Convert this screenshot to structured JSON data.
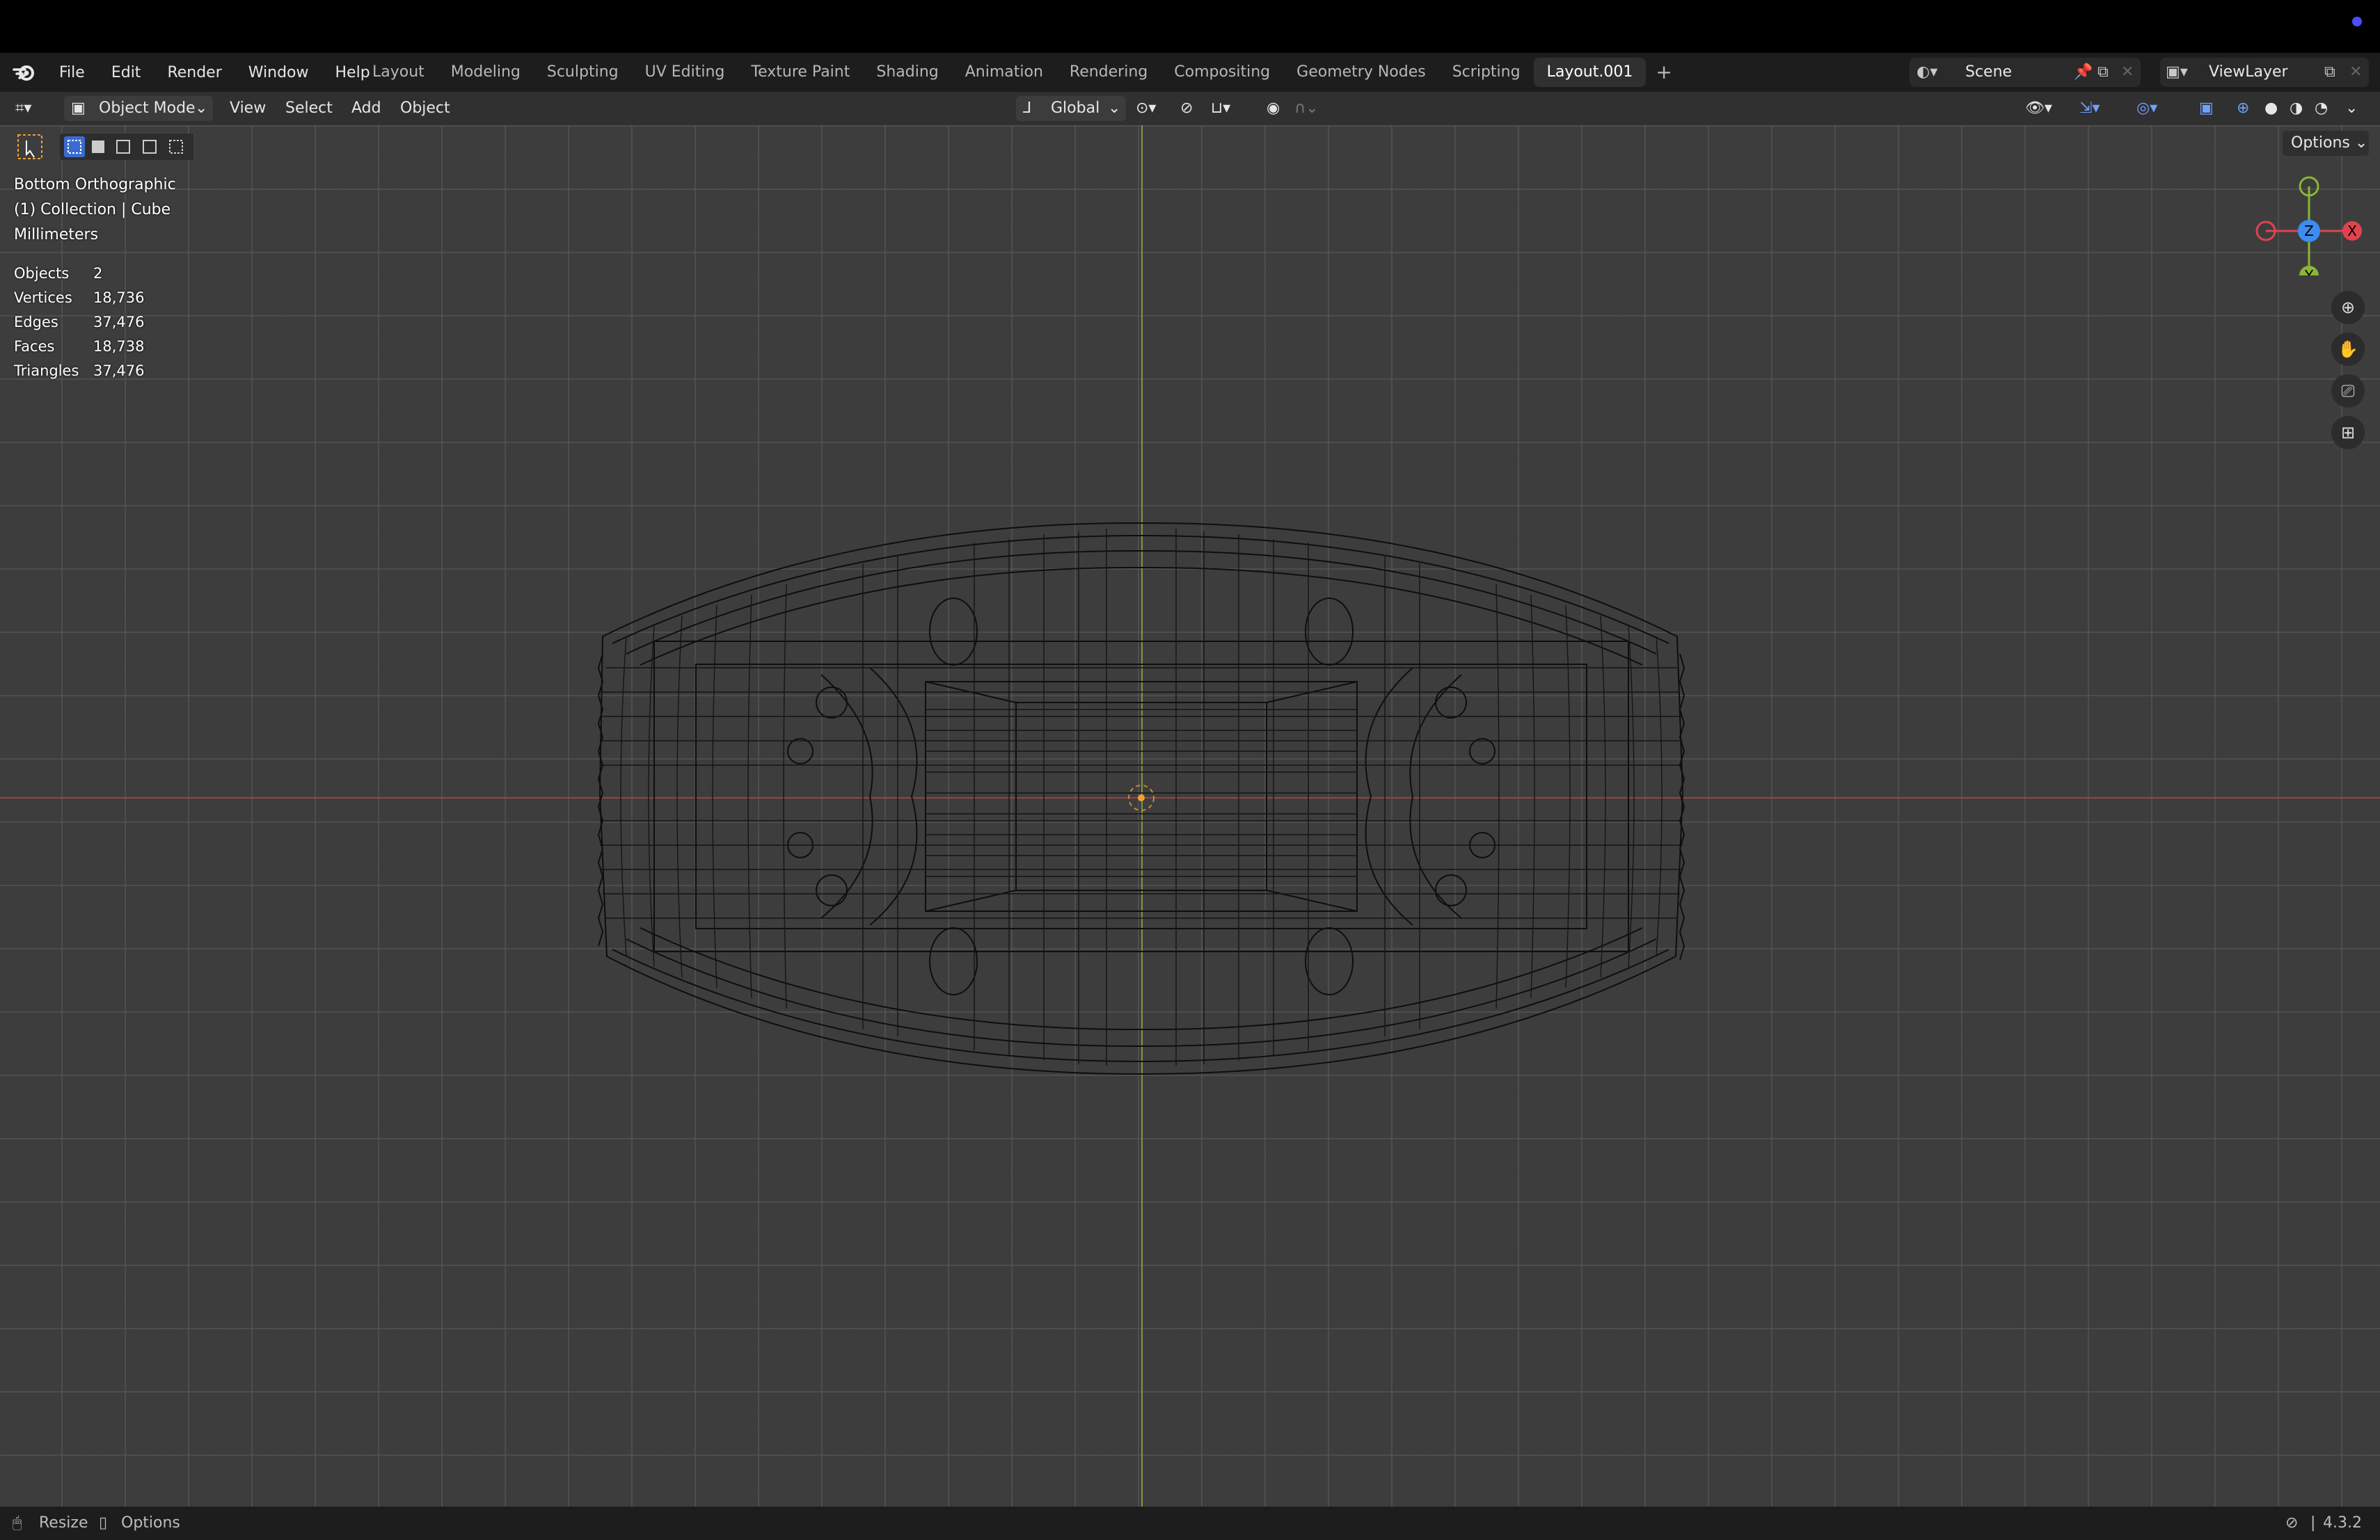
{
  "top_menu": [
    "File",
    "Edit",
    "Render",
    "Window",
    "Help"
  ],
  "workspaces": [
    "Layout",
    "Modeling",
    "Sculpting",
    "UV Editing",
    "Texture Paint",
    "Shading",
    "Animation",
    "Rendering",
    "Compositing",
    "Geometry Nodes",
    "Scripting",
    "Layout.001"
  ],
  "active_workspace": "Layout.001",
  "scene": "Scene",
  "view_layer": "ViewLayer",
  "header": {
    "mode": "Object Mode",
    "menus": [
      "View",
      "Select",
      "Add",
      "Object"
    ],
    "orientation": "Global",
    "options": "Options"
  },
  "overlay": {
    "view_name": "Bottom Orthographic",
    "collection": "(1) Collection | Cube",
    "units": "Millimeters"
  },
  "stats": [
    {
      "label": "Objects",
      "value": "2"
    },
    {
      "label": "Vertices",
      "value": "18,736"
    },
    {
      "label": "Edges",
      "value": "37,476"
    },
    {
      "label": "Faces",
      "value": "18,738"
    },
    {
      "label": "Triangles",
      "value": "37,476"
    }
  ],
  "gizmo": {
    "top": "",
    "center": "Z",
    "right": "X",
    "bottom": "Y"
  },
  "status_bar": {
    "left1": "Resize",
    "left2": "Options",
    "version": "4.3.2"
  },
  "colors": {
    "x_axis": "#9e4040",
    "y_axis": "#7b9a3a",
    "active_blue": "#3a6bd0",
    "gizmo_x": "#e0434f",
    "gizmo_y": "#8ab536",
    "gizmo_z": "#3d8cf0"
  }
}
